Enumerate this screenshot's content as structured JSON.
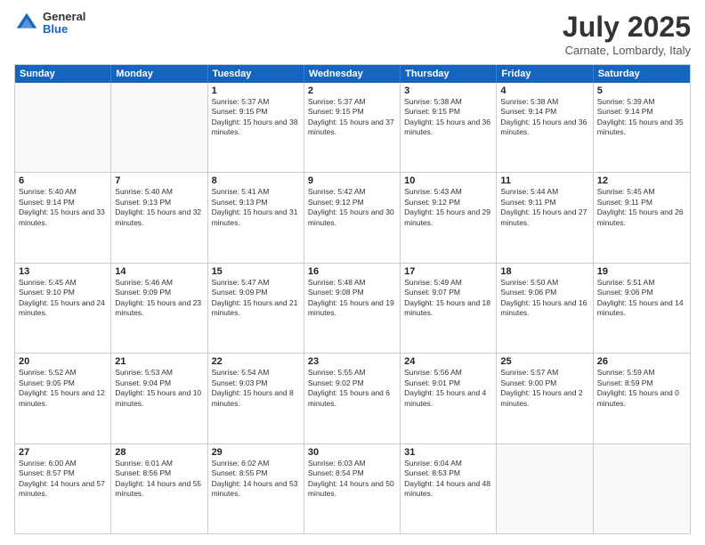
{
  "header": {
    "logo": {
      "general": "General",
      "blue": "Blue"
    },
    "month": "July 2025",
    "location": "Carnate, Lombardy, Italy"
  },
  "weekdays": [
    "Sunday",
    "Monday",
    "Tuesday",
    "Wednesday",
    "Thursday",
    "Friday",
    "Saturday"
  ],
  "rows": [
    [
      {
        "day": "",
        "detail": ""
      },
      {
        "day": "",
        "detail": ""
      },
      {
        "day": "1",
        "detail": "Sunrise: 5:37 AM\nSunset: 9:15 PM\nDaylight: 15 hours and 38 minutes."
      },
      {
        "day": "2",
        "detail": "Sunrise: 5:37 AM\nSunset: 9:15 PM\nDaylight: 15 hours and 37 minutes."
      },
      {
        "day": "3",
        "detail": "Sunrise: 5:38 AM\nSunset: 9:15 PM\nDaylight: 15 hours and 36 minutes."
      },
      {
        "day": "4",
        "detail": "Sunrise: 5:38 AM\nSunset: 9:14 PM\nDaylight: 15 hours and 36 minutes."
      },
      {
        "day": "5",
        "detail": "Sunrise: 5:39 AM\nSunset: 9:14 PM\nDaylight: 15 hours and 35 minutes."
      }
    ],
    [
      {
        "day": "6",
        "detail": "Sunrise: 5:40 AM\nSunset: 9:14 PM\nDaylight: 15 hours and 33 minutes."
      },
      {
        "day": "7",
        "detail": "Sunrise: 5:40 AM\nSunset: 9:13 PM\nDaylight: 15 hours and 32 minutes."
      },
      {
        "day": "8",
        "detail": "Sunrise: 5:41 AM\nSunset: 9:13 PM\nDaylight: 15 hours and 31 minutes."
      },
      {
        "day": "9",
        "detail": "Sunrise: 5:42 AM\nSunset: 9:12 PM\nDaylight: 15 hours and 30 minutes."
      },
      {
        "day": "10",
        "detail": "Sunrise: 5:43 AM\nSunset: 9:12 PM\nDaylight: 15 hours and 29 minutes."
      },
      {
        "day": "11",
        "detail": "Sunrise: 5:44 AM\nSunset: 9:11 PM\nDaylight: 15 hours and 27 minutes."
      },
      {
        "day": "12",
        "detail": "Sunrise: 5:45 AM\nSunset: 9:11 PM\nDaylight: 15 hours and 26 minutes."
      }
    ],
    [
      {
        "day": "13",
        "detail": "Sunrise: 5:45 AM\nSunset: 9:10 PM\nDaylight: 15 hours and 24 minutes."
      },
      {
        "day": "14",
        "detail": "Sunrise: 5:46 AM\nSunset: 9:09 PM\nDaylight: 15 hours and 23 minutes."
      },
      {
        "day": "15",
        "detail": "Sunrise: 5:47 AM\nSunset: 9:09 PM\nDaylight: 15 hours and 21 minutes."
      },
      {
        "day": "16",
        "detail": "Sunrise: 5:48 AM\nSunset: 9:08 PM\nDaylight: 15 hours and 19 minutes."
      },
      {
        "day": "17",
        "detail": "Sunrise: 5:49 AM\nSunset: 9:07 PM\nDaylight: 15 hours and 18 minutes."
      },
      {
        "day": "18",
        "detail": "Sunrise: 5:50 AM\nSunset: 9:06 PM\nDaylight: 15 hours and 16 minutes."
      },
      {
        "day": "19",
        "detail": "Sunrise: 5:51 AM\nSunset: 9:06 PM\nDaylight: 15 hours and 14 minutes."
      }
    ],
    [
      {
        "day": "20",
        "detail": "Sunrise: 5:52 AM\nSunset: 9:05 PM\nDaylight: 15 hours and 12 minutes."
      },
      {
        "day": "21",
        "detail": "Sunrise: 5:53 AM\nSunset: 9:04 PM\nDaylight: 15 hours and 10 minutes."
      },
      {
        "day": "22",
        "detail": "Sunrise: 5:54 AM\nSunset: 9:03 PM\nDaylight: 15 hours and 8 minutes."
      },
      {
        "day": "23",
        "detail": "Sunrise: 5:55 AM\nSunset: 9:02 PM\nDaylight: 15 hours and 6 minutes."
      },
      {
        "day": "24",
        "detail": "Sunrise: 5:56 AM\nSunset: 9:01 PM\nDaylight: 15 hours and 4 minutes."
      },
      {
        "day": "25",
        "detail": "Sunrise: 5:57 AM\nSunset: 9:00 PM\nDaylight: 15 hours and 2 minutes."
      },
      {
        "day": "26",
        "detail": "Sunrise: 5:59 AM\nSunset: 8:59 PM\nDaylight: 15 hours and 0 minutes."
      }
    ],
    [
      {
        "day": "27",
        "detail": "Sunrise: 6:00 AM\nSunset: 8:57 PM\nDaylight: 14 hours and 57 minutes."
      },
      {
        "day": "28",
        "detail": "Sunrise: 6:01 AM\nSunset: 8:56 PM\nDaylight: 14 hours and 55 minutes."
      },
      {
        "day": "29",
        "detail": "Sunrise: 6:02 AM\nSunset: 8:55 PM\nDaylight: 14 hours and 53 minutes."
      },
      {
        "day": "30",
        "detail": "Sunrise: 6:03 AM\nSunset: 8:54 PM\nDaylight: 14 hours and 50 minutes."
      },
      {
        "day": "31",
        "detail": "Sunrise: 6:04 AM\nSunset: 8:53 PM\nDaylight: 14 hours and 48 minutes."
      },
      {
        "day": "",
        "detail": ""
      },
      {
        "day": "",
        "detail": ""
      }
    ]
  ]
}
